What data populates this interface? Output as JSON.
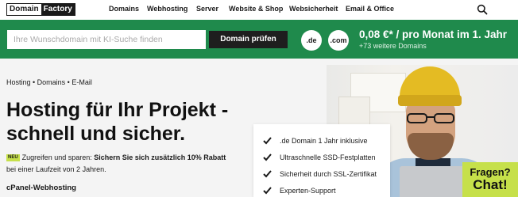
{
  "header": {
    "logo_left": "Domain",
    "logo_right": "Factory",
    "nav": [
      "Domains",
      "Webhosting",
      "Server",
      "Website & Shop",
      "Websicherheit",
      "Email & Office"
    ]
  },
  "domain_search": {
    "placeholder": "Ihre Wunschdomain mit KI-Suche finden",
    "value": "",
    "button_label": "Domain prüfen",
    "tlds": [
      ".de",
      ".com"
    ],
    "price": "0,08 €* / pro Monat im 1. Jahr",
    "more_domains": "+73 weitere Domains"
  },
  "main": {
    "breadcrumb": "Hosting • Domains • E-Mail",
    "headline_line1": "Hosting für Ihr Projekt -",
    "headline_line2": "schnell und sicher.",
    "badge": "NEU",
    "promo_lead": "Zugreifen und sparen:",
    "promo_bold": "Sichern Sie sich zusätzlich 10% Rabatt",
    "promo_tail": "bei einer Laufzeit von 2 Jahren.",
    "subheading": "cPanel-Webhosting"
  },
  "features": [
    ".de Domain 1 Jahr inklusive",
    "Ultraschnelle SSD-Festplatten",
    "Sicherheit durch SSL-Zertifikat",
    "Experten-Support"
  ],
  "chat": {
    "line1": "Fragen?",
    "line2": "Chat!"
  },
  "colors": {
    "brand_green": "#1f8a4c",
    "accent_lime": "#c6e04a",
    "dark": "#1e1e1e"
  },
  "icons": {
    "search": "search-icon",
    "check": "check-icon"
  }
}
